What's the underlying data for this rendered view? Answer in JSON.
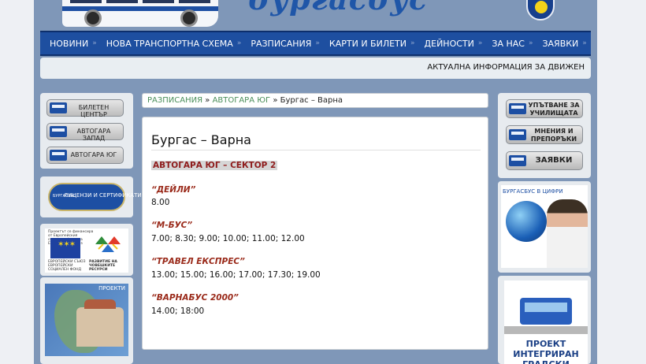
{
  "header": {
    "logo_text": "бургасбус",
    "nav": [
      {
        "label": "НОВИНИ"
      },
      {
        "label": "НОВА ТРАНСПОРТНА СХЕМА"
      },
      {
        "label": "РАЗПИСАНИЯ"
      },
      {
        "label": "КАРТИ И БИЛЕТИ"
      },
      {
        "label": "ДЕЙНОСТИ"
      },
      {
        "label": "ЗА НАС"
      },
      {
        "label": "ЗАЯВКИ"
      }
    ],
    "nav_arrow": "»",
    "ticker": "АКТУАЛНА ИНФОРМАЦИЯ ЗА ДВИЖЕН"
  },
  "left_sidebar": {
    "buttons": [
      {
        "label": "БИЛЕТЕН ЦЕНТЪР"
      },
      {
        "label": "АВТОГАРА ЗАПАД"
      },
      {
        "label": "АВТОГАРА ЮГ"
      }
    ],
    "license_badge": {
      "brand": "БУРГАСБУС",
      "label": "ЛИЦЕНЗИ И СЕРТИФИКАТИ"
    },
    "eu_banner": {
      "top_text": "Проектът се финансира от Европейския социален фонд на Европейския съюз",
      "left_caption": "ЕВРОПЕЙСКИ СЪЮЗ ЕВРОПЕЙСКИ СОЦИАЛЕН ФОНД",
      "right_caption": "РАЗВИТИЕ НА ЧОВЕШКИТЕ РЕСУРСИ"
    },
    "projects_label": "ПРОЕКТИ"
  },
  "breadcrumb": {
    "link1": "РАЗПИСАНИЯ",
    "sep": "»",
    "link2": "АВТОГАРА ЮГ",
    "current": "Бургас – Варна"
  },
  "content": {
    "title": "Бургас – Варна",
    "sector": "АВТОГАРА ЮГ – СЕКТОР 2",
    "carriers": [
      {
        "name": "“ДЕЙЛИ”",
        "times": "8.00"
      },
      {
        "name": "“М-БУС”",
        "times": "7.00; 8.30; 9.00; 10.00; 11.00; 12.00"
      },
      {
        "name": "“ТРАВЕЛ ЕКСПРЕС”",
        "times": "13.00; 15.00; 16.00; 17.00; 17.30; 19.00"
      },
      {
        "name": "“ВАРНАБУС 2000”",
        "times": "14.00; 18:00"
      }
    ]
  },
  "right_sidebar": {
    "buttons": [
      {
        "label": "УПЪТВАНЕ ЗА УЧИЛИЩАТА"
      },
      {
        "label": "МНЕНИЯ И ПРЕПОРЪКИ"
      },
      {
        "label": "ЗАЯВКИ"
      }
    ],
    "stats_title": "БУРГАСБУС В ЦИФРИ",
    "project_title": "ПРОЕКТ ИНТЕГРИРАН ГРАДСКИ"
  }
}
